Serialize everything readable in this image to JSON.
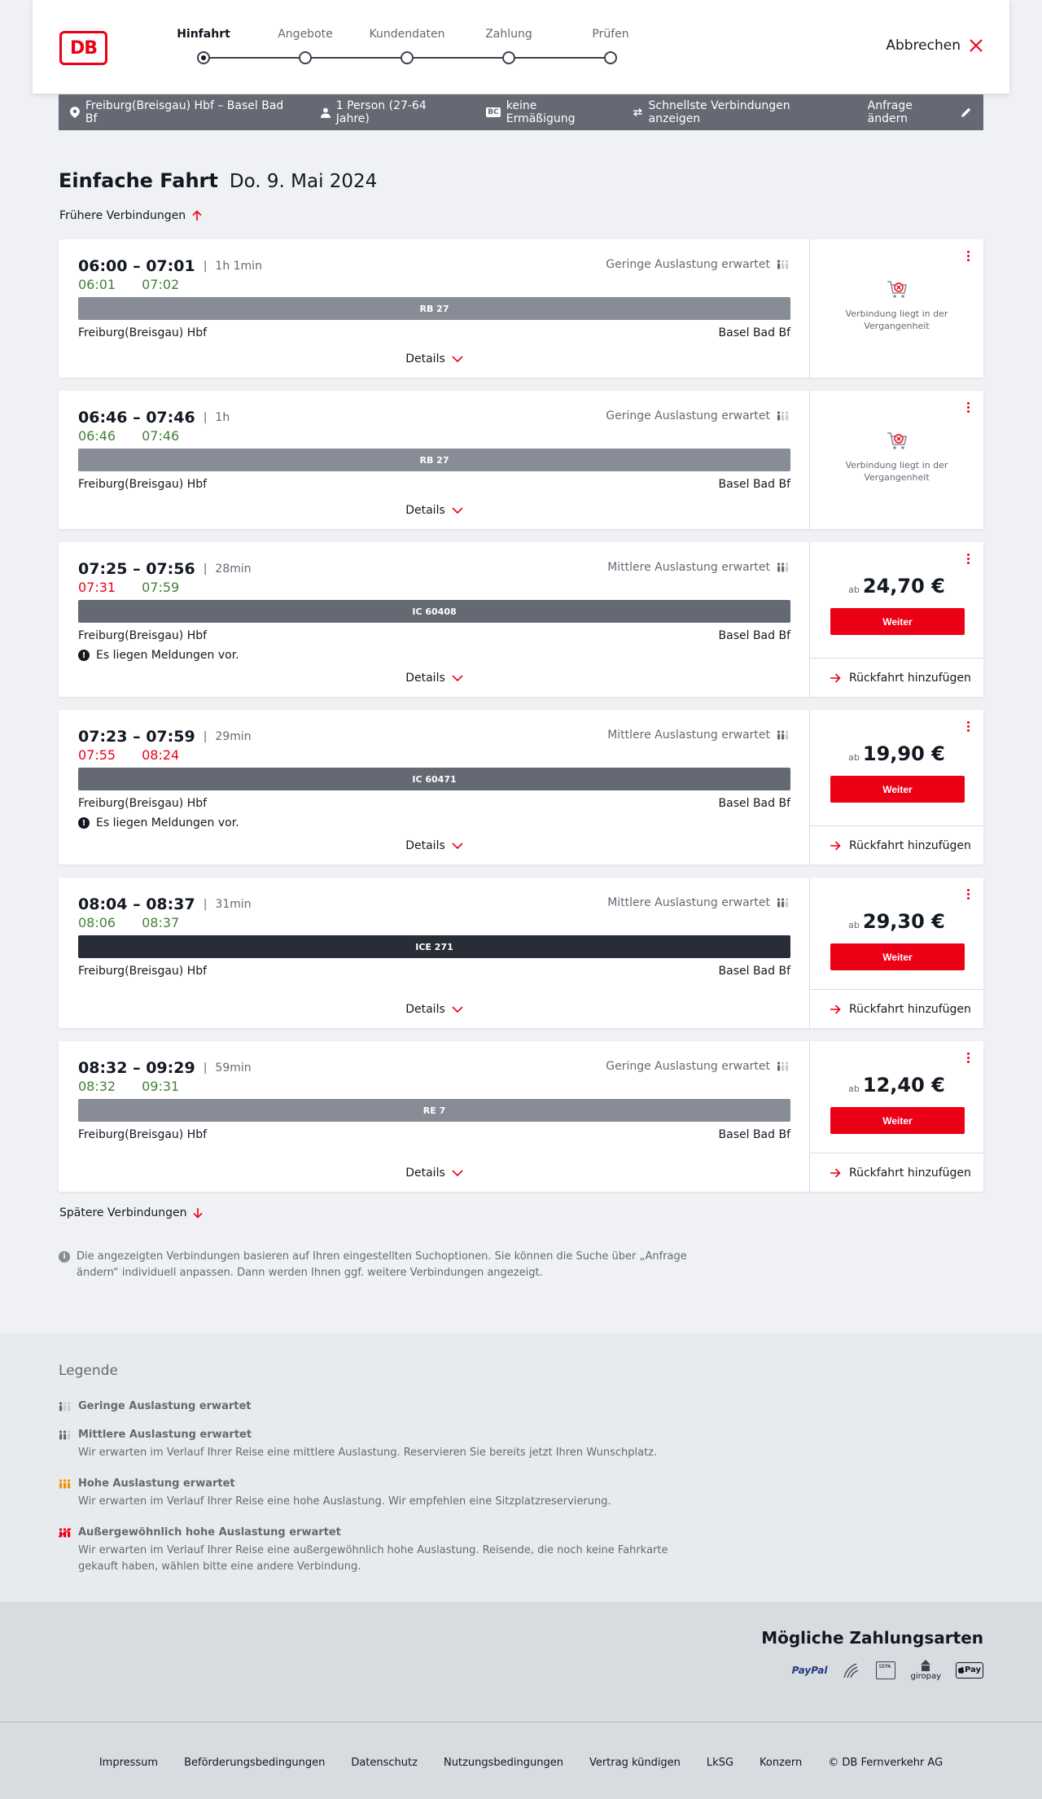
{
  "header": {
    "logo_text": "DB",
    "cancel_label": "Abbrechen",
    "steps": [
      {
        "label": "Hinfahrt",
        "active": true
      },
      {
        "label": "Angebote",
        "active": false
      },
      {
        "label": "Kundendaten",
        "active": false
      },
      {
        "label": "Zahlung",
        "active": false
      },
      {
        "label": "Prüfen",
        "active": false
      }
    ]
  },
  "search": {
    "route": "Freiburg(Breisgau) Hbf – Basel Bad Bf",
    "travellers": "1 Person (27-64 Jahre)",
    "bc_badge": "BC",
    "discount": "keine Ermäßigung",
    "fastest": "Schnellste Verbindungen anzeigen",
    "change": "Anfrage ändern"
  },
  "main": {
    "title": "Einfache Fahrt",
    "date": "Do. 9. Mai 2024",
    "earlier": "Frühere Verbindungen",
    "later": "Spätere Verbindungen",
    "info": "Die angezeigten Verbindungen basieren auf Ihren eingestellten Suchoptionen. Sie können die Suche über „Anfrage ändern“ individuell anpassen. Dann werden Ihnen ggf. weitere Verbindungen angezeigt."
  },
  "labels": {
    "details": "Details",
    "past": "Verbindung liegt in der Vergangenheit",
    "price_prefix": "ab",
    "weiter": "Weiter",
    "return": "Rückfahrt hinzufügen",
    "message": "Es liegen Meldungen vor."
  },
  "connections": [
    {
      "time": "06:00 – 07:01",
      "duration": "1h 1min",
      "rt_dep": "06:01",
      "rt_arr": "07:02",
      "rt_dep_status": "green",
      "rt_arr_status": "green",
      "load": "Geringe Auslastung erwartet",
      "train": "RB 27",
      "train_type": "regional",
      "from": "Freiburg(Breisgau) Hbf",
      "to": "Basel Bad Bf",
      "message": false,
      "past": true,
      "price": ""
    },
    {
      "time": "06:46 – 07:46",
      "duration": "1h",
      "rt_dep": "06:46",
      "rt_arr": "07:46",
      "rt_dep_status": "green",
      "rt_arr_status": "green",
      "load": "Geringe Auslastung erwartet",
      "train": "RB 27",
      "train_type": "regional",
      "from": "Freiburg(Breisgau) Hbf",
      "to": "Basel Bad Bf",
      "message": false,
      "past": true,
      "price": ""
    },
    {
      "time": "07:25 – 07:56",
      "duration": "28min",
      "rt_dep": "07:31",
      "rt_arr": "07:59",
      "rt_dep_status": "red",
      "rt_arr_status": "green",
      "load": "Mittlere Auslastung erwartet",
      "train": "IC 60408",
      "train_type": "ic",
      "from": "Freiburg(Breisgau) Hbf",
      "to": "Basel Bad Bf",
      "message": true,
      "past": false,
      "price": "24,70 €"
    },
    {
      "time": "07:23 – 07:59",
      "duration": "29min",
      "rt_dep": "07:55",
      "rt_arr": "08:24",
      "rt_dep_status": "red",
      "rt_arr_status": "red",
      "load": "Mittlere Auslastung erwartet",
      "train": "IC 60471",
      "train_type": "ic",
      "from": "Freiburg(Breisgau) Hbf",
      "to": "Basel Bad Bf",
      "message": true,
      "past": false,
      "price": "19,90 €"
    },
    {
      "time": "08:04 – 08:37",
      "duration": "31min",
      "rt_dep": "08:06",
      "rt_arr": "08:37",
      "rt_dep_status": "green",
      "rt_arr_status": "green",
      "load": "Mittlere Auslastung erwartet",
      "train": "ICE 271",
      "train_type": "ice",
      "from": "Freiburg(Breisgau) Hbf",
      "to": "Basel Bad Bf",
      "message": false,
      "past": false,
      "price": "29,30 €"
    },
    {
      "time": "08:32 – 09:29",
      "duration": "59min",
      "rt_dep": "08:32",
      "rt_arr": "09:31",
      "rt_dep_status": "green",
      "rt_arr_status": "green",
      "load": "Geringe Auslastung erwartet",
      "train": "RE 7",
      "train_type": "regional",
      "from": "Freiburg(Breisgau) Hbf",
      "to": "Basel Bad Bf",
      "message": false,
      "past": false,
      "price": "12,40 €"
    }
  ],
  "legend": {
    "title": "Legende",
    "items": [
      {
        "label": "Geringe Auslastung erwartet",
        "desc": "",
        "level": 1
      },
      {
        "label": "Mittlere Auslastung erwartet",
        "desc": "Wir erwarten im Verlauf Ihrer Reise eine mittlere Auslastung. Reservieren Sie bereits jetzt Ihren Wunschplatz.",
        "level": 2
      },
      {
        "label": "Hohe Auslastung erwartet",
        "desc": "Wir erwarten im Verlauf Ihrer Reise eine hohe Auslastung. Wir empfehlen eine Sitzplatzreservierung.",
        "level": 3
      },
      {
        "label": "Außergewöhnlich hohe Auslastung erwartet",
        "desc": "Wir erwarten im Verlauf Ihrer Reise eine außergewöhnlich hohe Auslastung. Reisende, die noch keine Fahrkarte gekauft haben, wählen bitte eine andere Verbindung.",
        "level": 4
      }
    ]
  },
  "payment": {
    "title": "Mögliche Zahlungsarten",
    "paypal": "PayPal",
    "sepa": "SEPA",
    "giropay": "giropay",
    "applepay": "Pay"
  },
  "footer": {
    "links": [
      "Impressum",
      "Beförderungsbedingungen",
      "Datenschutz",
      "Nutzungsbedingungen",
      "Vertrag kündigen",
      "LkSG",
      "Konzern",
      "© DB Fernverkehr AG"
    ]
  },
  "colors": {
    "brand_red": "#ec0016",
    "realtime_green": "#408335",
    "load_medium": "#646973",
    "load_high": "#f39200",
    "load_extreme": "#ec0016"
  }
}
